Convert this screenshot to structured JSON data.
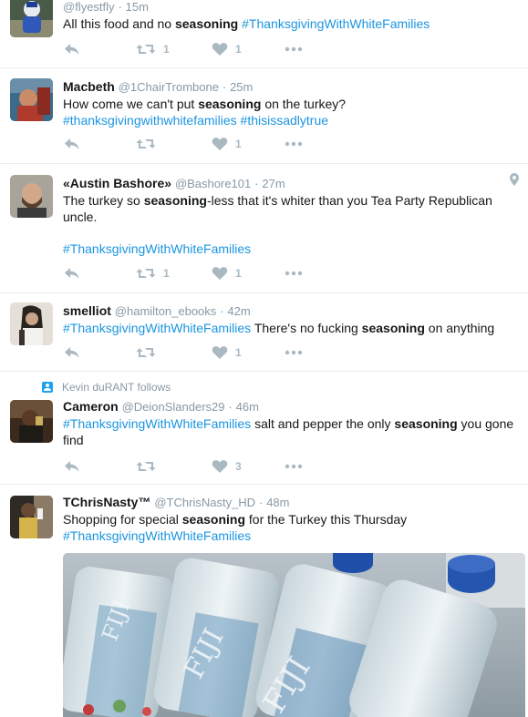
{
  "colors": {
    "link": "#1b95e0",
    "muted": "#8899a6",
    "action": "#aab8c2",
    "divider": "#e6ecf0"
  },
  "icons": {
    "reply": "reply-arrow-icon",
    "retweet": "retweet-icon",
    "like": "heart-icon",
    "more": "ellipsis-icon",
    "geo": "location-pin-icon",
    "context": "person-follow-icon"
  },
  "tweets": [
    {
      "handle": "@flyestfly",
      "dot": "·",
      "time": "15m",
      "text_before": "All this food and no ",
      "bold": "seasoning",
      "text_after": " ",
      "hashtag": "#ThanksgivingWithWhiteFamilies",
      "retweets": "1",
      "likes": "1"
    },
    {
      "name": "Macbeth",
      "handle": "@1ChairTrombone",
      "dot": "·",
      "time": "25m",
      "text_before": "How come we can't put ",
      "bold": "seasoning",
      "text_after": " on the turkey?",
      "hashtag1": "#thanksgivingwithwhitefamilies",
      "hashtag2": "#thisissadlytrue",
      "retweets": "",
      "likes": "1"
    },
    {
      "name": "«Austin Bashore»",
      "handle": "@Bashore101",
      "dot": "·",
      "time": "27m",
      "text_before": "The turkey so ",
      "bold": "seasoning",
      "text_after": "-less that it's whiter than you Tea Party Republican uncle.",
      "hashtag": "#ThanksgivingWithWhiteFamilies",
      "retweets": "1",
      "likes": "1"
    },
    {
      "name": "smelliot",
      "handle": "@hamilton_ebooks",
      "dot": "·",
      "time": "42m",
      "hashtag": "#ThanksgivingWithWhiteFamilies",
      "text_before": " There's no fucking ",
      "bold": "seasoning",
      "text_after": " on anything",
      "retweets": "",
      "likes": "1"
    },
    {
      "context": "Kevin duRANT follows",
      "name": "Cameron",
      "handle": "@DeionSlanders29",
      "dot": "·",
      "time": "46m",
      "hashtag": "#ThanksgivingWithWhiteFamilies",
      "text_before": " salt and pepper the only ",
      "bold": "seasoning",
      "text_after": " you gone find",
      "retweets": "",
      "likes": "3"
    },
    {
      "name": "TChrisNasty™",
      "handle": "@TChrisNasty_HD",
      "dot": "·",
      "time": "48m",
      "text_before": "Shopping for special ",
      "bold": "seasoning",
      "text_after": " for the Turkey this Thursday",
      "hashtag": "#ThanksgivingWithWhiteFamilies",
      "media_brand": "FIJI"
    }
  ]
}
